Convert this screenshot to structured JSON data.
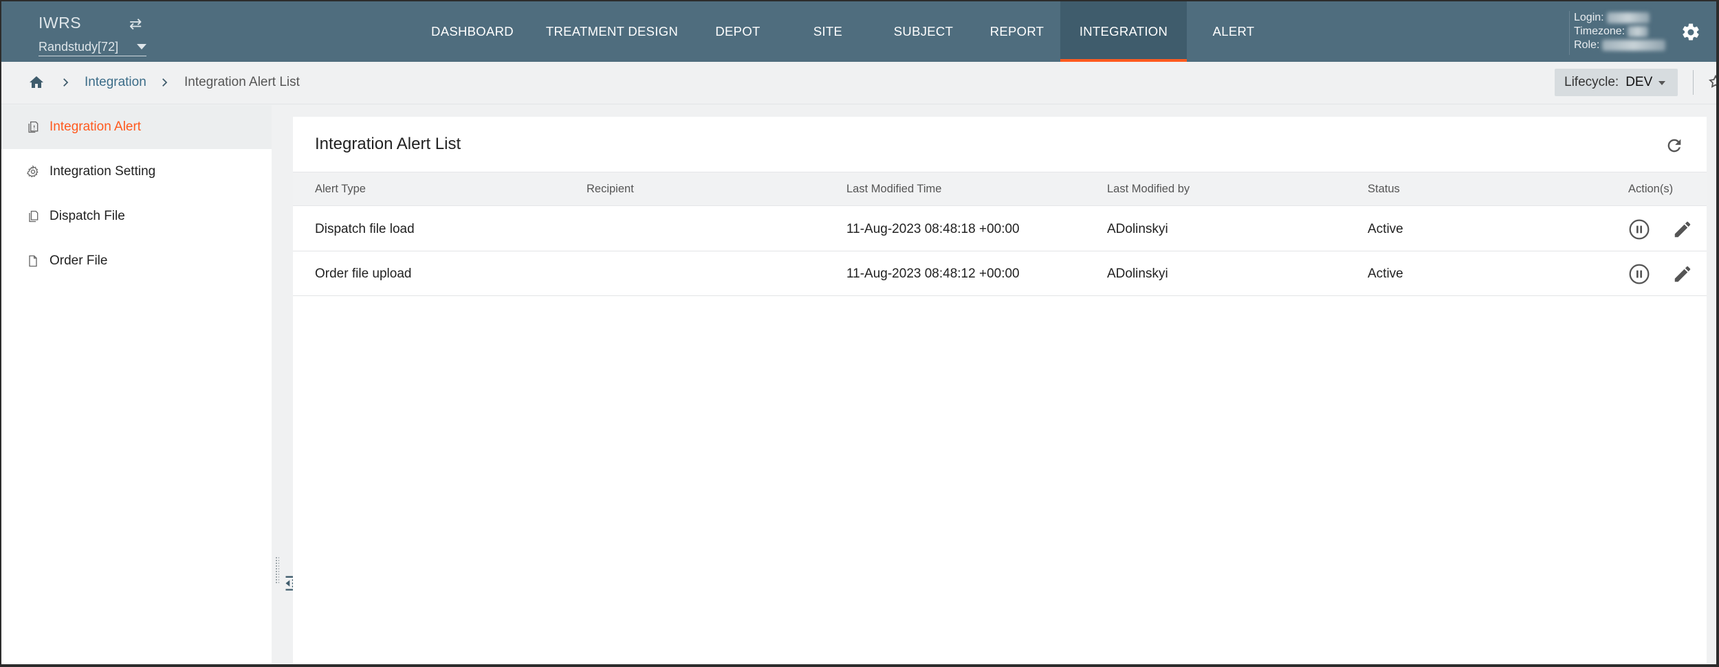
{
  "app": {
    "title": "IWRS",
    "study": "Randstudy[72]"
  },
  "nav": {
    "items": [
      {
        "label": "DASHBOARD",
        "active": false
      },
      {
        "label": "TREATMENT DESIGN",
        "active": false
      },
      {
        "label": "DEPOT",
        "active": false
      },
      {
        "label": "SITE",
        "active": false
      },
      {
        "label": "SUBJECT",
        "active": false
      },
      {
        "label": "REPORT",
        "active": false
      },
      {
        "label": "INTEGRATION",
        "active": true
      },
      {
        "label": "ALERT",
        "active": false
      }
    ]
  },
  "user": {
    "login_label": "Login:",
    "timezone_label": "Timezone:",
    "role_label": "Role:"
  },
  "breadcrumb": {
    "items": [
      "Integration",
      "Integration Alert List"
    ]
  },
  "lifecycle": {
    "label": "Lifecycle:",
    "value": "DEV"
  },
  "sidebar": {
    "items": [
      {
        "label": "Integration Alert",
        "icon": "alert-file-icon",
        "active": true
      },
      {
        "label": "Integration Setting",
        "icon": "gear-icon",
        "active": false
      },
      {
        "label": "Dispatch File",
        "icon": "copy-file-icon",
        "active": false
      },
      {
        "label": "Order File",
        "icon": "file-icon",
        "active": false
      }
    ]
  },
  "main": {
    "title": "Integration Alert List",
    "columns": [
      "Alert Type",
      "Recipient",
      "Last Modified Time",
      "Last Modified by",
      "Status",
      "Action(s)"
    ],
    "rows": [
      {
        "alert_type": "Dispatch file load",
        "recipient": "",
        "last_modified_time": "11-Aug-2023 08:48:18 +00:00",
        "last_modified_by": "ADolinskyi",
        "status": "Active"
      },
      {
        "alert_type": "Order file upload",
        "recipient": "",
        "last_modified_time": "11-Aug-2023 08:48:12 +00:00",
        "last_modified_by": "ADolinskyi",
        "status": "Active"
      }
    ]
  },
  "colors": {
    "topbar": "#4f6d7e",
    "accent": "#ff5a1f",
    "link": "#3b6c88"
  }
}
